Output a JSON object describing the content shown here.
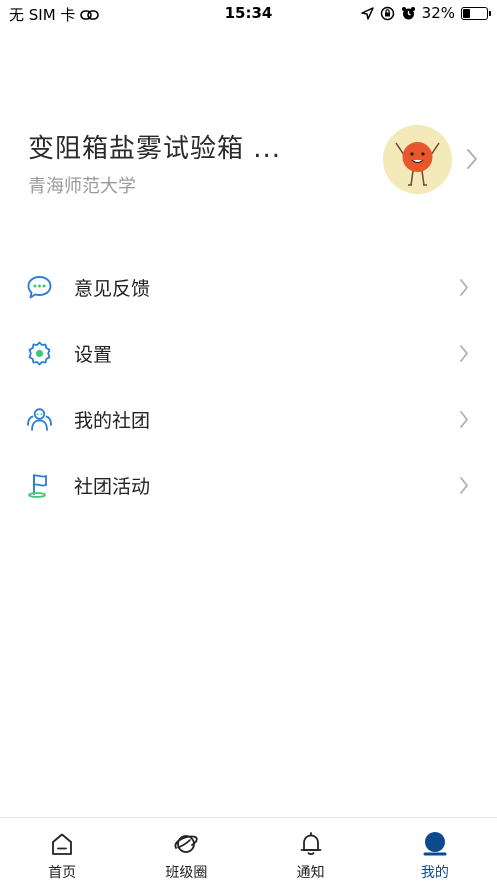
{
  "status_bar": {
    "carrier": "无 SIM 卡",
    "time": "15:34",
    "battery_percent": "32%",
    "battery_level": 0.32
  },
  "profile": {
    "name": "变阻箱盐雾试验箱 ...",
    "school": "青海师范大学"
  },
  "menu": {
    "items": [
      {
        "label": "意见反馈",
        "icon": "feedback-chat-icon"
      },
      {
        "label": "设置",
        "icon": "settings-gear-icon"
      },
      {
        "label": "我的社团",
        "icon": "club-people-icon"
      },
      {
        "label": "社团活动",
        "icon": "activity-flag-icon"
      }
    ]
  },
  "tab_bar": {
    "tabs": [
      {
        "label": "首页",
        "icon": "home-icon",
        "active": false
      },
      {
        "label": "班级圈",
        "icon": "planet-icon",
        "active": false
      },
      {
        "label": "通知",
        "icon": "bell-icon",
        "active": false
      },
      {
        "label": "我的",
        "icon": "profile-icon",
        "active": true
      }
    ]
  },
  "colors": {
    "accent": "#0d4a8c",
    "icon_blue": "#2b7fd6",
    "icon_green": "#3ac97a",
    "secondary_text": "#9a9a9a"
  }
}
